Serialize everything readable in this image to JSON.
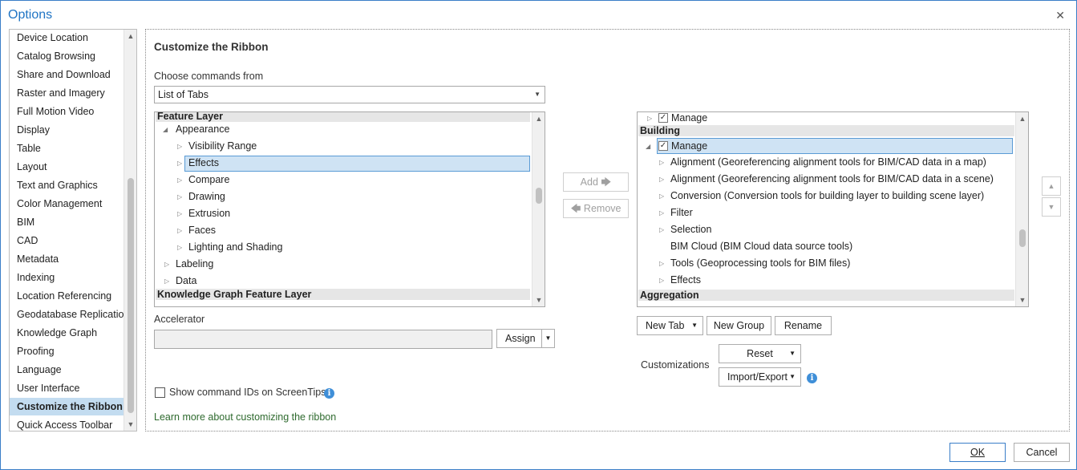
{
  "window": {
    "title": "Options",
    "close_glyph": "✕"
  },
  "nav": {
    "items": [
      "Device Location",
      "Catalog Browsing",
      "Share and Download",
      "Raster and Imagery",
      "Full Motion Video",
      "Display",
      "Table",
      "Layout",
      "Text and Graphics",
      "Color Management",
      "BIM",
      "CAD",
      "Metadata",
      "Indexing",
      "Location Referencing",
      "Geodatabase Replication",
      "Knowledge Graph",
      "Proofing",
      "Language",
      "User Interface",
      "Customize the Ribbon",
      "Quick Access Toolbar"
    ],
    "selected": "Customize the Ribbon"
  },
  "content": {
    "heading": "Customize the Ribbon",
    "choose_label": "Choose commands from",
    "choose_value": "List of Tabs",
    "left_tree": {
      "group1": "Feature Layer",
      "appearance": "Appearance",
      "appearance_children": [
        "Visibility Range",
        "Effects",
        "Compare",
        "Drawing",
        "Extrusion",
        "Faces",
        "Lighting and Shading"
      ],
      "labeling": "Labeling",
      "data": "Data",
      "group2": "Knowledge Graph Feature Layer",
      "selected": "Effects"
    },
    "add_label": "Add",
    "remove_label": "Remove",
    "right_tree": {
      "top_manage": "Manage",
      "group1": "Building",
      "manage": "Manage",
      "children": [
        "Alignment (Georeferencing alignment tools for BIM/CAD data in a map)",
        "Alignment (Georeferencing alignment tools for BIM/CAD data in a scene)",
        "Conversion (Conversion tools for building layer to building scene layer)",
        "Filter",
        "Selection",
        "BIM Cloud (BIM Cloud data source tools)",
        "Tools (Geoprocessing tools for BIM files)",
        "Effects"
      ],
      "group2": "Aggregation"
    },
    "accelerator_label": "Accelerator",
    "accelerator_value": "",
    "assign_label": "Assign",
    "new_tab_label": "New Tab",
    "new_group_label": "New Group",
    "rename_label": "Rename",
    "customizations_label": "Customizations",
    "reset_label": "Reset",
    "import_export_label": "Import/Export",
    "show_ids_label": "Show command IDs on ScreenTips",
    "show_ids_checked": false,
    "learn_more_link": "Learn more about customizing the ribbon"
  },
  "footer": {
    "ok_label": "OK",
    "cancel_label": "Cancel"
  },
  "colors": {
    "accent": "#1f74c4",
    "selection": "#c3dcf0",
    "info": "#3f8fd8",
    "link": "#2e6a2e"
  }
}
